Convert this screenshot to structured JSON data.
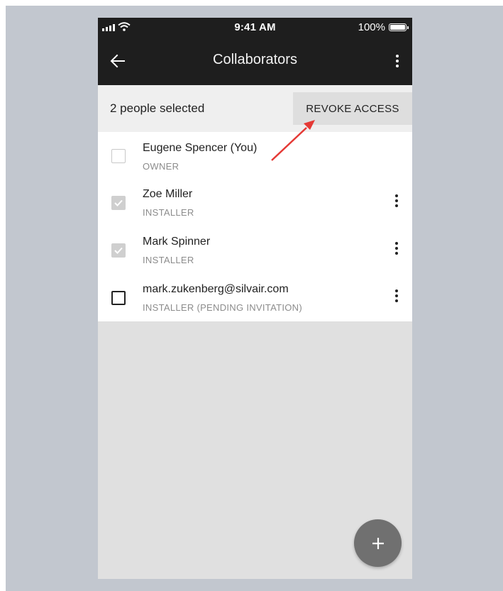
{
  "status_bar": {
    "time": "9:41 AM",
    "battery": "100%"
  },
  "app_bar": {
    "title": "Collaborators",
    "back_icon": "arrow-left-icon",
    "menu_icon": "more-vert-icon"
  },
  "selection_bar": {
    "text": "2 people selected",
    "action_label": "REVOKE ACCESS"
  },
  "collaborators": [
    {
      "name": "Eugene Spencer (You)",
      "role": "OWNER",
      "checked": false,
      "checkbox_enabled": false,
      "has_menu": false
    },
    {
      "name": "Zoe Miller",
      "role": "INSTALLER",
      "checked": true,
      "checkbox_enabled": false,
      "has_menu": true
    },
    {
      "name": "Mark Spinner",
      "role": "INSTALLER",
      "checked": true,
      "checkbox_enabled": false,
      "has_menu": true
    },
    {
      "name": "mark.zukenberg@silvair.com",
      "role": "INSTALLER (PENDING INVITATION)",
      "checked": false,
      "checkbox_enabled": true,
      "has_menu": true
    }
  ],
  "fab": {
    "icon": "plus-icon"
  },
  "colors": {
    "app_bar": "#1e1e1e",
    "annotation_arrow": "#e53935",
    "fab": "#707070",
    "background": "#c2c7cf"
  }
}
